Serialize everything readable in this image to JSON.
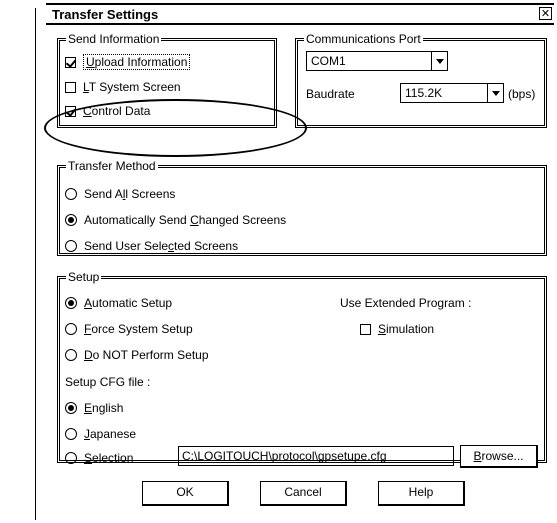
{
  "dialog": {
    "title": "Transfer Settings",
    "close_glyph": "✕"
  },
  "send_information": {
    "label": "Send Information",
    "items": [
      {
        "pre": "",
        "u": "U",
        "post": "pload Information",
        "checked": true
      },
      {
        "pre": "",
        "u": "L",
        "post": "T System Screen",
        "checked": false
      },
      {
        "pre": "",
        "u": "C",
        "post": "ontrol Data",
        "checked": true
      }
    ]
  },
  "communications_port": {
    "label": "Communications Port",
    "port_value": "COM1",
    "baudrate_label": "Baudrate",
    "baudrate_value": "115.2K",
    "unit": "(bps)"
  },
  "transfer_method": {
    "label": "Transfer Method",
    "options": [
      {
        "pre": "Send A",
        "u": "l",
        "post": "l Screens",
        "selected": false
      },
      {
        "pre": "Automatically Send ",
        "u": "C",
        "post": "hanged Screens",
        "selected": true
      },
      {
        "pre": "Send User Sele",
        "u": "c",
        "post": "ted Screens",
        "selected": false
      }
    ]
  },
  "setup": {
    "label": "Setup",
    "options": [
      {
        "pre": "",
        "u": "A",
        "post": "utomatic Setup",
        "selected": true
      },
      {
        "pre": "",
        "u": "F",
        "post": "orce System Setup",
        "selected": false
      },
      {
        "pre": "",
        "u": "D",
        "post": "o NOT Perform Setup",
        "selected": false
      }
    ],
    "extended_label": "Use Extended Program :",
    "simulation": {
      "pre": "",
      "u": "S",
      "post": "imulation",
      "checked": false
    },
    "cfg_label": "Setup CFG file :",
    "cfg_options": [
      {
        "pre": "",
        "u": "E",
        "post": "nglish",
        "selected": true
      },
      {
        "pre": "",
        "u": "J",
        "post": "apanese",
        "selected": false
      },
      {
        "pre": "",
        "u": "S",
        "post": "election",
        "selected": false
      }
    ],
    "cfg_path": "C:\\LOGITOUCH\\protocol\\gpsetupe.cfg",
    "browse": {
      "u": "B",
      "post": "rowse..."
    }
  },
  "buttons": {
    "ok": "OK",
    "cancel": "Cancel",
    "help": "Help"
  }
}
